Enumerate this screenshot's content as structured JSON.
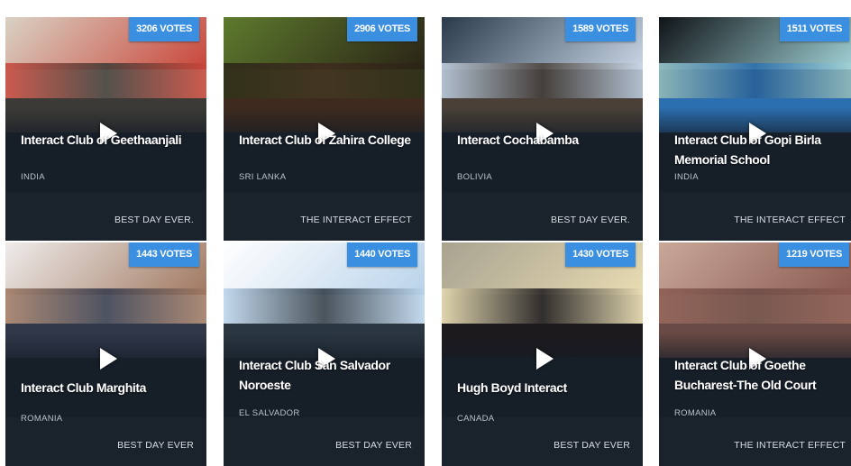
{
  "cards": [
    {
      "votes": "3206 VOTES",
      "title": "Interact Club of Geethaanjali",
      "country": "INDIA",
      "slogan": "BEST DAY EVER.",
      "thumb_colors": [
        "#d9d2c4",
        "#c9463a",
        "#3c3a36"
      ]
    },
    {
      "votes": "2906 VOTES",
      "title": "Interact Club of Zahira College",
      "country": "SRI LANKA",
      "slogan": "THE INTERACT EFFECT",
      "thumb_colors": [
        "#5d7a2d",
        "#2a2416",
        "#3e2a1e"
      ]
    },
    {
      "votes": "1589 VOTES",
      "title": "Interact Cochabamba",
      "country": "BOLIVIA",
      "slogan": "BEST DAY EVER.",
      "thumb_colors": [
        "#2a3a4a",
        "#c8d6e6",
        "#4a4038"
      ]
    },
    {
      "votes": "1511 VOTES",
      "title": "Interact Club of Gopi Birla Memorial School",
      "country": "INDIA",
      "slogan": "THE INTERACT EFFECT",
      "thumb_colors": [
        "#101418",
        "#9fd0d4",
        "#2b6fb0"
      ]
    },
    {
      "votes": "1443 VOTES",
      "title": "Interact Club Marghita",
      "country": "ROMANIA",
      "slogan": "BEST DAY EVER",
      "thumb_colors": [
        "#efeceb",
        "#a07860",
        "#31384a"
      ]
    },
    {
      "votes": "1440 VOTES",
      "title": "Interact Club San Salvador Noroeste",
      "country": "EL SALVADOR",
      "slogan": "BEST DAY EVER",
      "thumb_colors": [
        "#ffffff",
        "#b9d3ea",
        "#2a3640"
      ]
    },
    {
      "votes": "1430 VOTES",
      "title": "Hugh Boyd Interact",
      "country": "CANADA",
      "slogan": "BEST DAY EVER",
      "thumb_colors": [
        "#a8a290",
        "#e8dcb2",
        "#1c1a1c"
      ]
    },
    {
      "votes": "1219 VOTES",
      "title": "Interact Club of Goethe Bucharest-The Old Court",
      "country": "ROMANIA",
      "slogan": "THE INTERACT EFFECT",
      "thumb_colors": [
        "#c9a898",
        "#8a5a50",
        "#6a4a44"
      ]
    }
  ]
}
